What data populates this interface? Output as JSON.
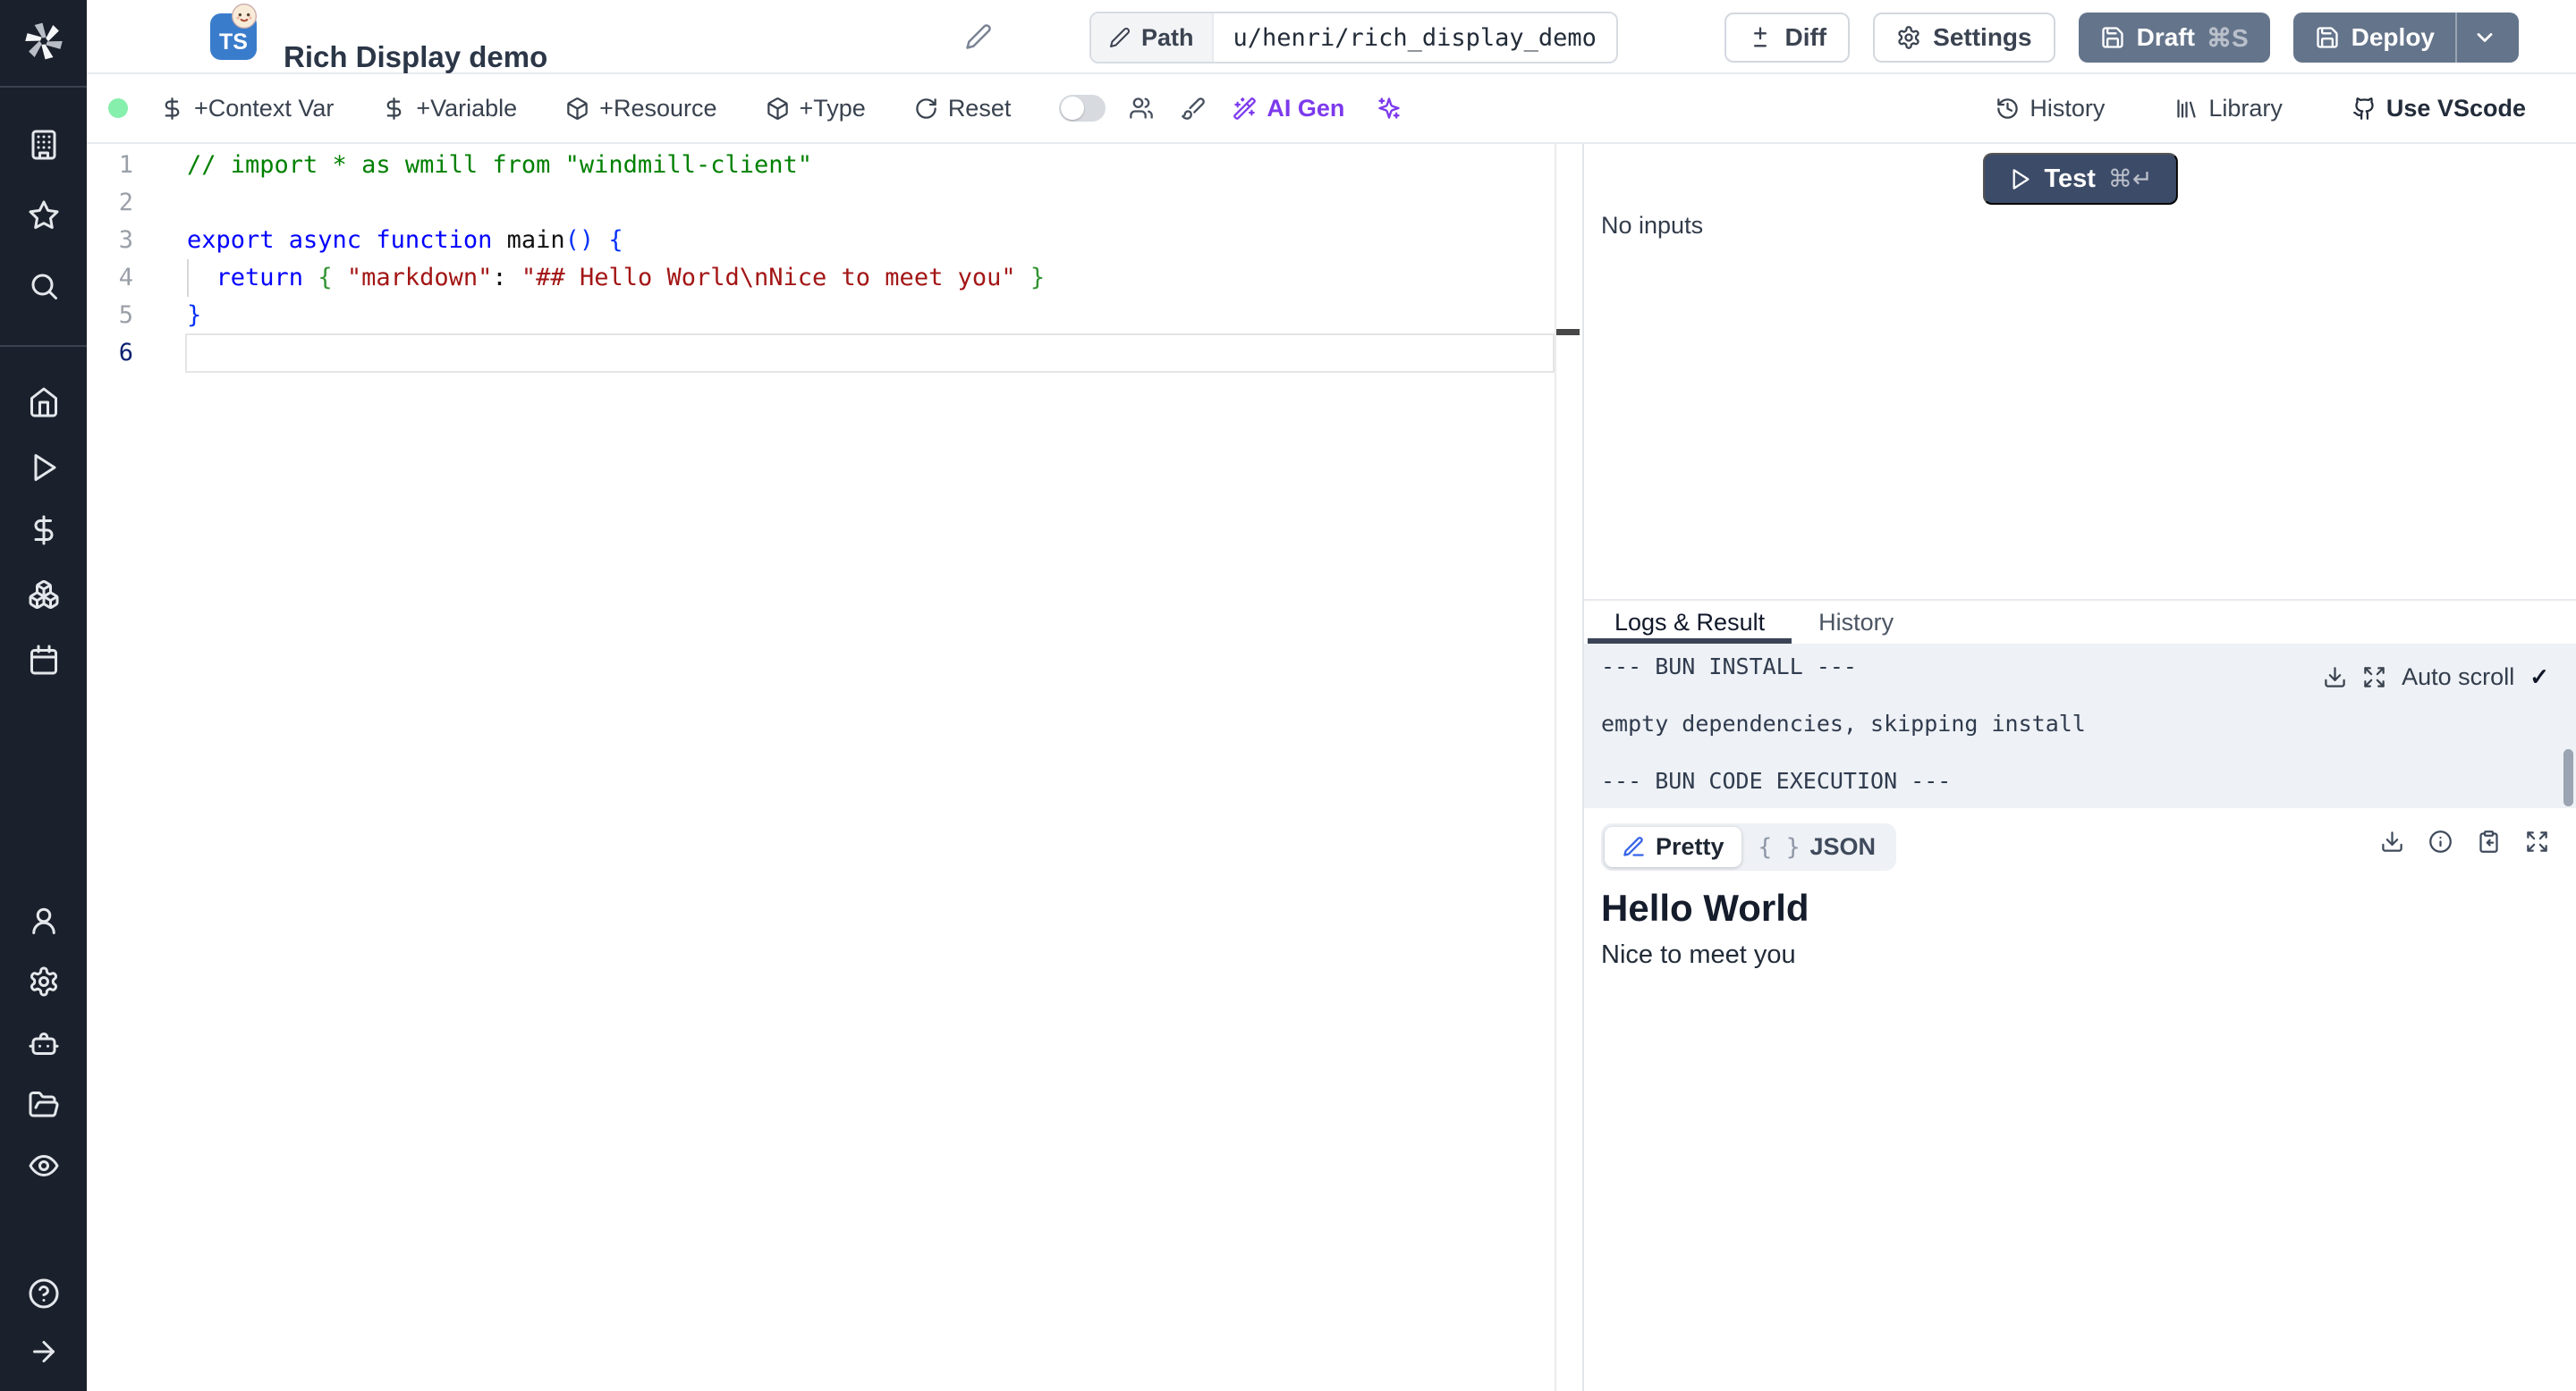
{
  "topbar": {
    "ts_badge": "TS",
    "title": "Rich Display demo",
    "path": {
      "label": "Path",
      "value": "u/henri/rich_display_demo"
    },
    "buttons": {
      "diff": "Diff",
      "settings": "Settings",
      "draft": "Draft",
      "draft_shortcut": "⌘S",
      "deploy": "Deploy"
    }
  },
  "toolbar": {
    "items": {
      "context_var": "+Context Var",
      "variable": "+Variable",
      "resource": "+Resource",
      "type": "+Type",
      "reset": "Reset",
      "ai_gen": "AI Gen"
    },
    "right": {
      "history": "History",
      "library": "Library",
      "use_vscode": "Use VScode"
    }
  },
  "editor": {
    "lines": [
      {
        "no": "1",
        "tokens": [
          [
            "cmt",
            "// import * as wmill from \"windmill-client\""
          ]
        ]
      },
      {
        "no": "2",
        "tokens": []
      },
      {
        "no": "3",
        "tokens": [
          [
            "kw",
            "export async function "
          ],
          [
            "pln",
            "main"
          ],
          [
            "b1",
            "() {"
          ]
        ]
      },
      {
        "no": "4",
        "tokens": [
          [
            "pln",
            "  "
          ],
          [
            "kw",
            "return"
          ],
          [
            "pln",
            " "
          ],
          [
            "b2",
            "{ "
          ],
          [
            "str",
            "\"markdown\""
          ],
          [
            "pln",
            ": "
          ],
          [
            "str",
            "\"## Hello World\\nNice to meet you\""
          ],
          [
            "pln",
            " "
          ],
          [
            "b2",
            "}"
          ]
        ]
      },
      {
        "no": "5",
        "tokens": [
          [
            "b1",
            "}"
          ]
        ]
      },
      {
        "no": "6",
        "active": true,
        "tokens": []
      }
    ]
  },
  "panel": {
    "test": {
      "label": "Test",
      "shortcut": "⌘↵"
    },
    "no_inputs": "No inputs",
    "tabs": [
      {
        "label": "Logs & Result"
      },
      {
        "label": "History"
      }
    ],
    "logs": {
      "lines": [
        "--- BUN INSTALL ---",
        "",
        "empty dependencies, skipping install",
        "",
        "--- BUN CODE EXECUTION ---"
      ],
      "auto_scroll": "Auto scroll",
      "check": "✓"
    },
    "result": {
      "pretty": "Pretty",
      "json": "JSON",
      "braces": "{ }",
      "title": "Hello World",
      "body": "Nice to meet you"
    }
  },
  "colors": {
    "accent_purple": "#7c3aed",
    "status_green": "#86efac",
    "button_slate": "#64748b",
    "test_navy": "#3c4b68",
    "ts_blue": "#3a7ccc",
    "sidebar_dark": "#1b212c"
  }
}
